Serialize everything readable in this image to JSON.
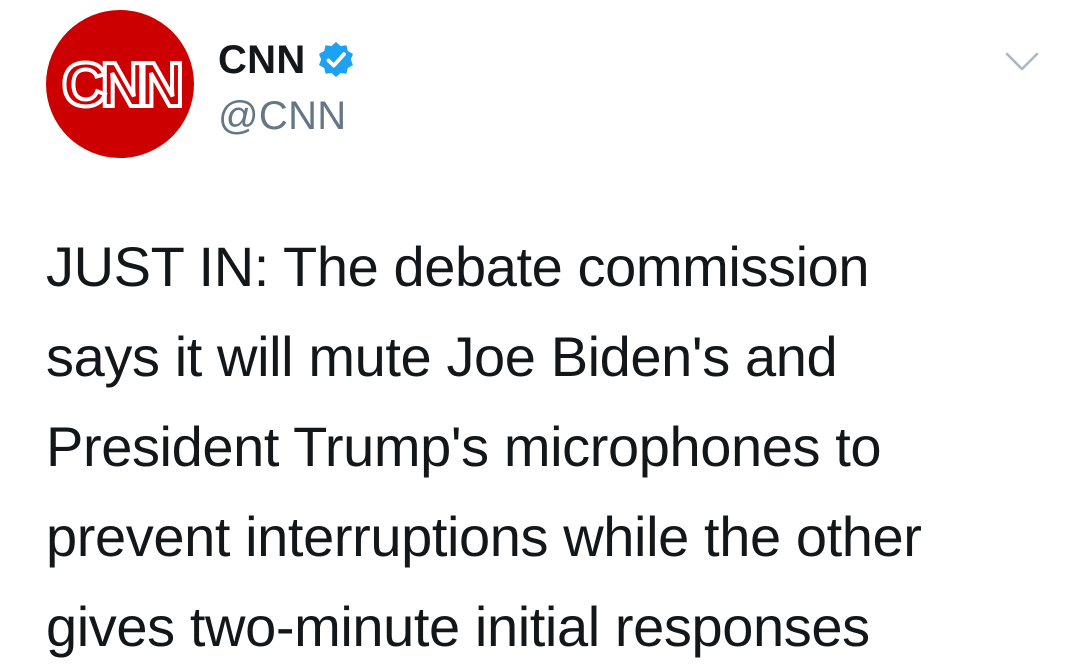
{
  "tweet": {
    "author": {
      "display_name": "CNN",
      "handle": "@CNN",
      "verified": true,
      "avatar_logo_text": "CNN",
      "avatar_color": "#cc0000"
    },
    "text_lines": [
      "JUST IN: The debate commission",
      "says it will mute Joe Biden's and",
      "President Trump's microphones to",
      "prevent interruptions while the other",
      "gives two-minute initial responses"
    ]
  },
  "colors": {
    "text_primary": "#14171a",
    "text_secondary": "#657786",
    "verified_blue": "#1da1f2",
    "caret_gray": "#aab8c2"
  },
  "icons": {
    "verified": "verified-badge-icon",
    "more": "chevron-down-icon"
  }
}
